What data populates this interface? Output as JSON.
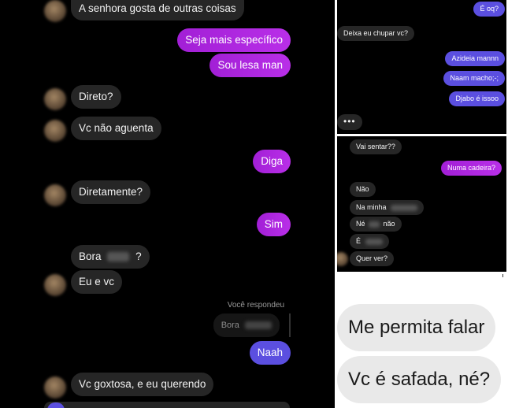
{
  "main": {
    "messages": [
      {
        "text": "A senhora gosta de outras coisas"
      },
      {
        "text": "Seja mais específico"
      },
      {
        "text": "Sou lesa man"
      },
      {
        "text": "Direto?"
      },
      {
        "text": "Vc não aguenta"
      },
      {
        "text": "Diga"
      },
      {
        "text": "Diretamente?"
      },
      {
        "text": "Sim"
      },
      {
        "text": "Bora",
        "suffix": "?"
      },
      {
        "text": "Eu e vc"
      },
      {
        "text": "Naah"
      },
      {
        "text": "Vc goxtosa, e eu querendo"
      }
    ],
    "reply_label": "Você respondeu",
    "reply_quote": "Bora"
  },
  "panel2": {
    "messages": [
      {
        "text": "É oq?"
      },
      {
        "text": "Deixa eu chupar vc?"
      },
      {
        "text": "Azideia mannn"
      },
      {
        "text": "Naam macho;-;"
      },
      {
        "text": "Djabo é issoo"
      }
    ],
    "typing": "•••"
  },
  "panel3": {
    "messages": [
      {
        "text": "Vai sentar??"
      },
      {
        "text": "Numa cadeira?"
      },
      {
        "text": "Não"
      },
      {
        "text": "Na minha"
      },
      {
        "text": "Né",
        "suffix": "não"
      },
      {
        "text": "É"
      },
      {
        "text": "Quer ver?"
      }
    ]
  },
  "panel4": {
    "messages": [
      {
        "text": "Me permita falar"
      },
      {
        "text": "Vc é safada, né?"
      }
    ]
  },
  "colors": {
    "outgoing_purple": "#b92fe8",
    "outgoing_blue": "#5b4fe0",
    "incoming": "#262626",
    "background": "#000000"
  }
}
